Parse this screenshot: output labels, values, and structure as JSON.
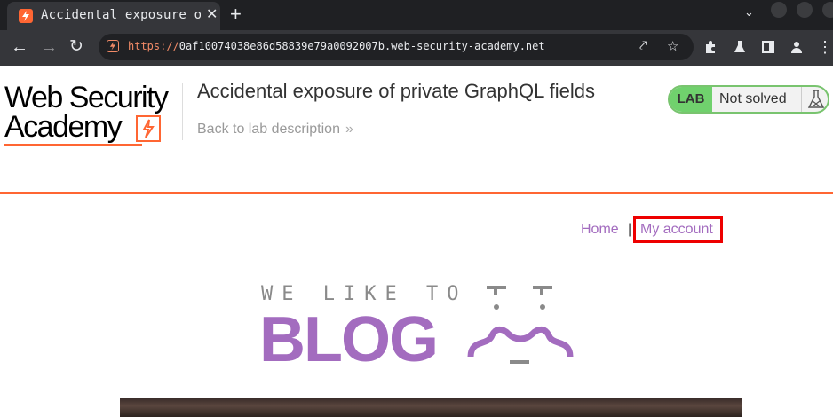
{
  "browser": {
    "tab_title": "Accidental exposure of private GraphQL fields",
    "new_tab_symbol": "+",
    "close_symbol": "✕",
    "url_scheme": "https://",
    "url_rest": "0af10074038e86d58839e79a0092007b.web-security-academy.net"
  },
  "header": {
    "logo_line1": "Web Security",
    "logo_line2": "Academy",
    "lab_title": "Accidental exposure of private GraphQL fields",
    "back_link": "Back to lab description",
    "status_badge": "LAB",
    "status_text": "Not solved"
  },
  "nav": {
    "home": "Home",
    "separator": "|",
    "my_account": "My account"
  },
  "banner": {
    "top_text": "WE LIKE TO",
    "main_text": "BLOG"
  },
  "colors": {
    "accent_orange": "#ff6633",
    "link_purple": "#a36cbf",
    "lab_green": "#70d16d",
    "highlight_red": "#e00000"
  }
}
